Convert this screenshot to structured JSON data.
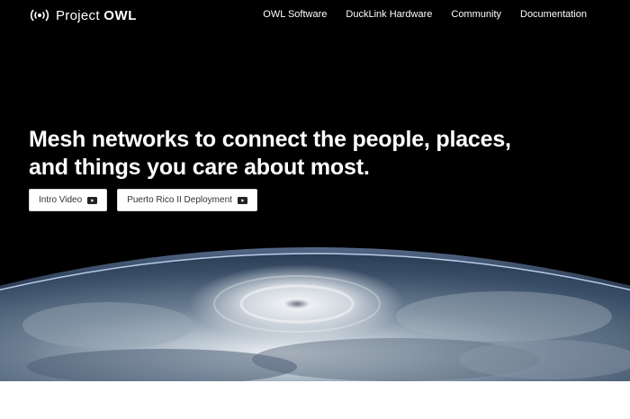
{
  "brand": {
    "name_light": "Project",
    "name_bold": "OWL",
    "icon": "radio-signal-icon"
  },
  "nav": {
    "items": [
      {
        "label": "OWL Software"
      },
      {
        "label": "DuckLink Hardware"
      },
      {
        "label": "Community"
      },
      {
        "label": "Documentation"
      }
    ]
  },
  "hero": {
    "headline": "Mesh networks to connect the people, places, and things you care about most.",
    "buttons": [
      {
        "label": "Intro Video",
        "icon": "video-play-icon"
      },
      {
        "label": "Puerto Rico II Deployment",
        "icon": "video-play-icon"
      }
    ],
    "background_image": "earth-from-orbit-hurricane"
  },
  "colors": {
    "hero_background": "#000000",
    "text_primary": "#ffffff",
    "button_background": "#ffffff",
    "button_text": "#333333"
  }
}
